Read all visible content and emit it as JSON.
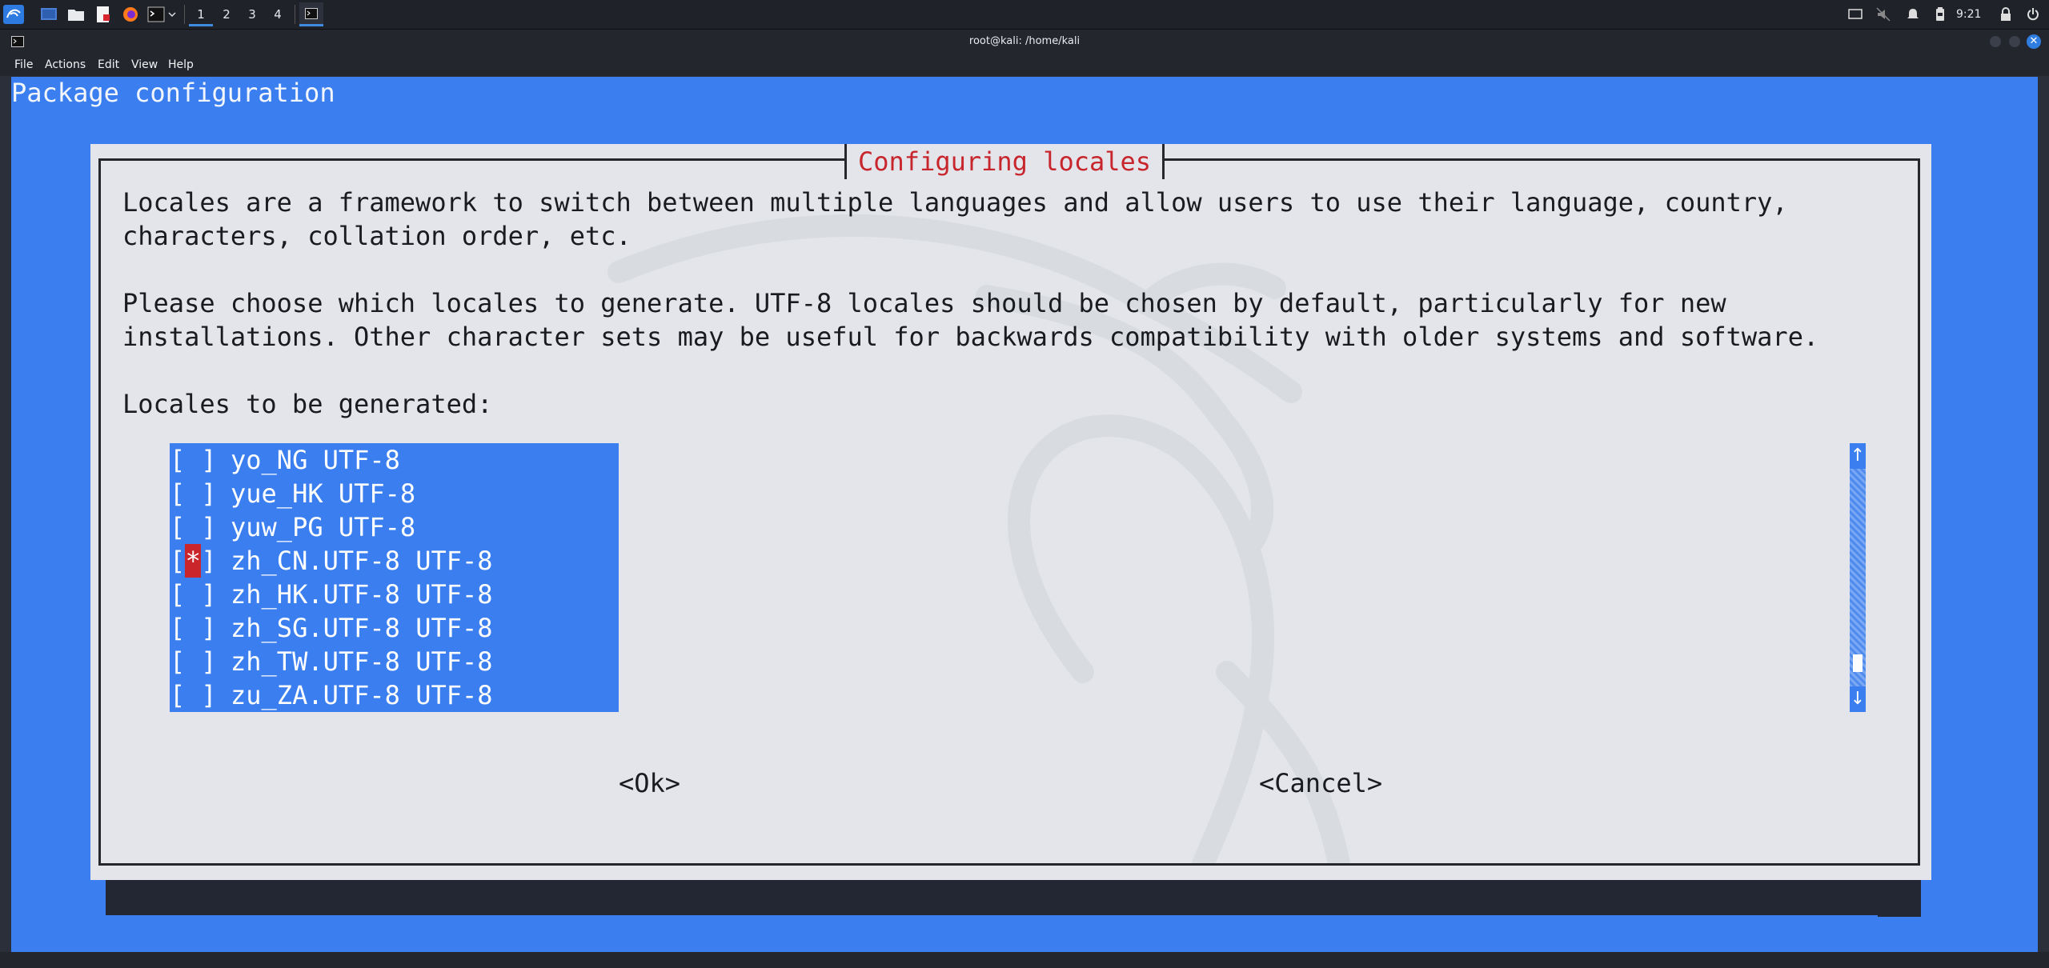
{
  "taskbar": {
    "workspaces": [
      "1",
      "2",
      "3",
      "4"
    ],
    "clock": "9:21"
  },
  "window": {
    "title": "root@kali: /home/kali"
  },
  "menubar": {
    "items": [
      "File",
      "Actions",
      "Edit",
      "View",
      "Help"
    ]
  },
  "terminal": {
    "header": "Package configuration"
  },
  "dialog": {
    "title": "Configuring locales",
    "description_lines": [
      "Locales are a framework to switch between multiple languages and allow users to use their language, country,",
      "characters, collation order, etc."
    ],
    "instruction_lines": [
      "Please choose which locales to generate. UTF-8 locales should be chosen by default, particularly for new",
      "installations. Other character sets may be useful for backwards compatibility with older systems and software."
    ],
    "list_label": "Locales to be generated:",
    "locales": [
      {
        "label": "yo_NG UTF-8",
        "checked": false
      },
      {
        "label": "yue_HK UTF-8",
        "checked": false
      },
      {
        "label": "yuw_PG UTF-8",
        "checked": false
      },
      {
        "label": "zh_CN.UTF-8 UTF-8",
        "checked": true
      },
      {
        "label": "zh_HK.UTF-8 UTF-8",
        "checked": false
      },
      {
        "label": "zh_SG.UTF-8 UTF-8",
        "checked": false
      },
      {
        "label": "zh_TW.UTF-8 UTF-8",
        "checked": false
      },
      {
        "label": "zu_ZA.UTF-8 UTF-8",
        "checked": false
      }
    ],
    "ok_label": "<Ok>",
    "cancel_label": "<Cancel>"
  },
  "colors": {
    "terminal_bg": "#3a7ef0",
    "dialog_bg": "#e3e5ea",
    "title_red": "#c8262d",
    "selected_mark": "#c9252a"
  }
}
